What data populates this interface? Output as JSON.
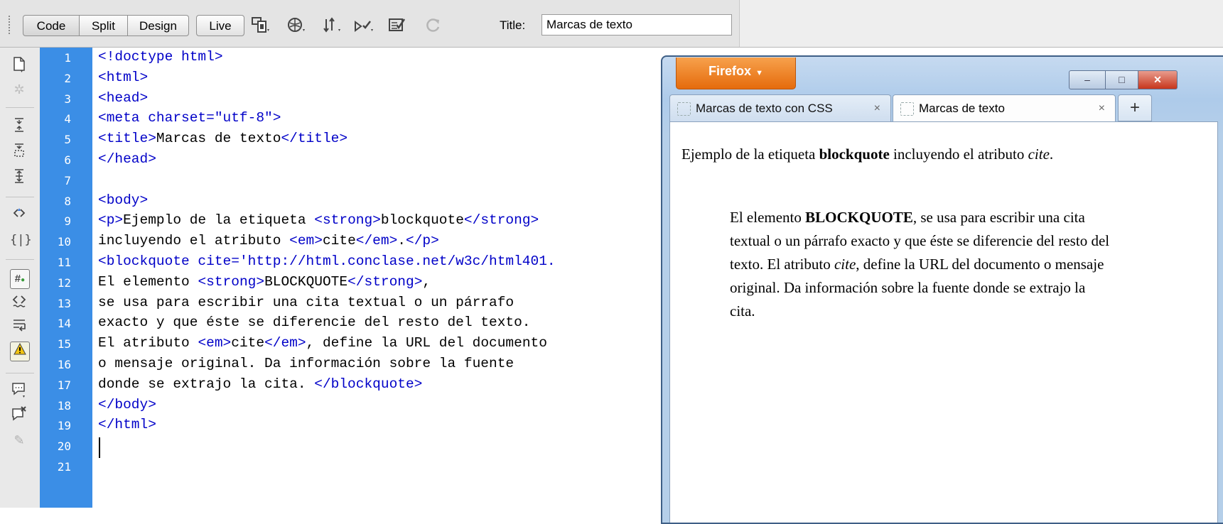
{
  "toolbar": {
    "view_buttons": {
      "code": "Code",
      "split": "Split",
      "design": "Design",
      "live": "Live"
    },
    "icons": [
      "multiscreen-icon",
      "preview-browser-icon",
      "file-management-icon",
      "w3c-validate-icon",
      "check-page-icon",
      "refresh-icon"
    ],
    "title_label": "Title:",
    "title_value": "Marcas de texto"
  },
  "toolstrip": {
    "icons": [
      "open-documents-icon",
      "show-code-navigator-icon",
      "collapse-full-tag-icon",
      "collapse-selection-icon",
      "expand-all-icon",
      "select-parent-tag-icon",
      "balance-braces-icon",
      "line-numbers-icon",
      "highlight-invalid-code-icon",
      "word-wrap-icon",
      "syntax-error-alerts-icon",
      "apply-comment-icon",
      "remove-comment-icon",
      "wrap-tag-icon"
    ]
  },
  "editor": {
    "line_numbers": [
      "1",
      "2",
      "3",
      "4",
      "5",
      "6",
      "7",
      "8",
      "9",
      "10",
      "11",
      "12",
      "13",
      "14",
      "15",
      "16",
      "17",
      "18",
      "19",
      "20",
      "21"
    ],
    "lines": [
      [
        {
          "t": "tag",
          "v": "<!doctype html>"
        }
      ],
      [
        {
          "t": "tag",
          "v": "<html>"
        }
      ],
      [
        {
          "t": "tag",
          "v": "<head>"
        }
      ],
      [
        {
          "t": "tag",
          "v": "<meta charset="
        },
        {
          "t": "str",
          "v": "\"utf-8\""
        },
        {
          "t": "tag",
          "v": ">"
        }
      ],
      [
        {
          "t": "tag",
          "v": "<title>"
        },
        {
          "t": "txt",
          "v": "Marcas de texto"
        },
        {
          "t": "tag",
          "v": "</title>"
        }
      ],
      [
        {
          "t": "tag",
          "v": "</head>"
        }
      ],
      [],
      [
        {
          "t": "tag",
          "v": "<body>"
        }
      ],
      [
        {
          "t": "tag",
          "v": "<p>"
        },
        {
          "t": "txt",
          "v": "Ejemplo de la etiqueta "
        },
        {
          "t": "tag",
          "v": "<strong>"
        },
        {
          "t": "txt",
          "v": "blockquote"
        },
        {
          "t": "tag",
          "v": "</strong>"
        }
      ],
      [
        {
          "t": "txt",
          "v": "incluyendo el atributo "
        },
        {
          "t": "tag",
          "v": "<em>"
        },
        {
          "t": "txt",
          "v": "cite"
        },
        {
          "t": "tag",
          "v": "</em>"
        },
        {
          "t": "txt",
          "v": "."
        },
        {
          "t": "tag",
          "v": "</p>"
        }
      ],
      [
        {
          "t": "tag",
          "v": "<blockquote cite="
        },
        {
          "t": "str",
          "v": "'http://html.conclase.net/w3c/html401."
        }
      ],
      [
        {
          "t": "txt",
          "v": "El elemento "
        },
        {
          "t": "tag",
          "v": "<strong>"
        },
        {
          "t": "txt",
          "v": "BLOCKQUOTE"
        },
        {
          "t": "tag",
          "v": "</strong>"
        },
        {
          "t": "txt",
          "v": ","
        }
      ],
      [
        {
          "t": "txt",
          "v": "se usa para escribir una cita textual o un párrafo"
        }
      ],
      [
        {
          "t": "txt",
          "v": "exacto y que éste se diferencie del resto del texto."
        }
      ],
      [
        {
          "t": "txt",
          "v": "El atributo "
        },
        {
          "t": "tag",
          "v": "<em>"
        },
        {
          "t": "txt",
          "v": "cite"
        },
        {
          "t": "tag",
          "v": "</em>"
        },
        {
          "t": "txt",
          "v": ", define la URL del documento"
        }
      ],
      [
        {
          "t": "txt",
          "v": "o mensaje original. Da información sobre la fuente"
        }
      ],
      [
        {
          "t": "txt",
          "v": "donde se extrajo la cita. "
        },
        {
          "t": "tag",
          "v": "</blockquote>"
        }
      ],
      [
        {
          "t": "tag",
          "v": "</body>"
        }
      ],
      [
        {
          "t": "tag",
          "v": "</html>"
        }
      ],
      [],
      []
    ],
    "caret_line": 20
  },
  "browser": {
    "menu_label": "Firefox",
    "window_buttons": {
      "minimize": "–",
      "maximize": "□",
      "close": "✕"
    },
    "tabs": [
      {
        "label": "Marcas de texto con CSS",
        "close": "×"
      },
      {
        "label": "Marcas de texto",
        "close": "×"
      }
    ],
    "new_tab_label": "+",
    "content": {
      "p_pre": "Ejemplo de la etiqueta ",
      "p_strong": "blockquote",
      "p_mid": " incluyendo el atributo ",
      "p_em": "cite",
      "p_end": ".",
      "bq_pre": "El elemento ",
      "bq_strong": "BLOCKQUOTE",
      "bq_mid1": ", se usa para escribir una cita textual o un párrafo exacto y que éste se diferencie del resto del texto. El atributo ",
      "bq_em": "cite",
      "bq_mid2": ", define la URL del documento o mensaje original. Da información sobre la fuente donde se extrajo la cita."
    }
  },
  "colors": {
    "gutter": "#3b8ee6",
    "code_tag": "#0000c8",
    "firefox_orange": "#e56b0c",
    "window_frame": "#aecbea"
  }
}
